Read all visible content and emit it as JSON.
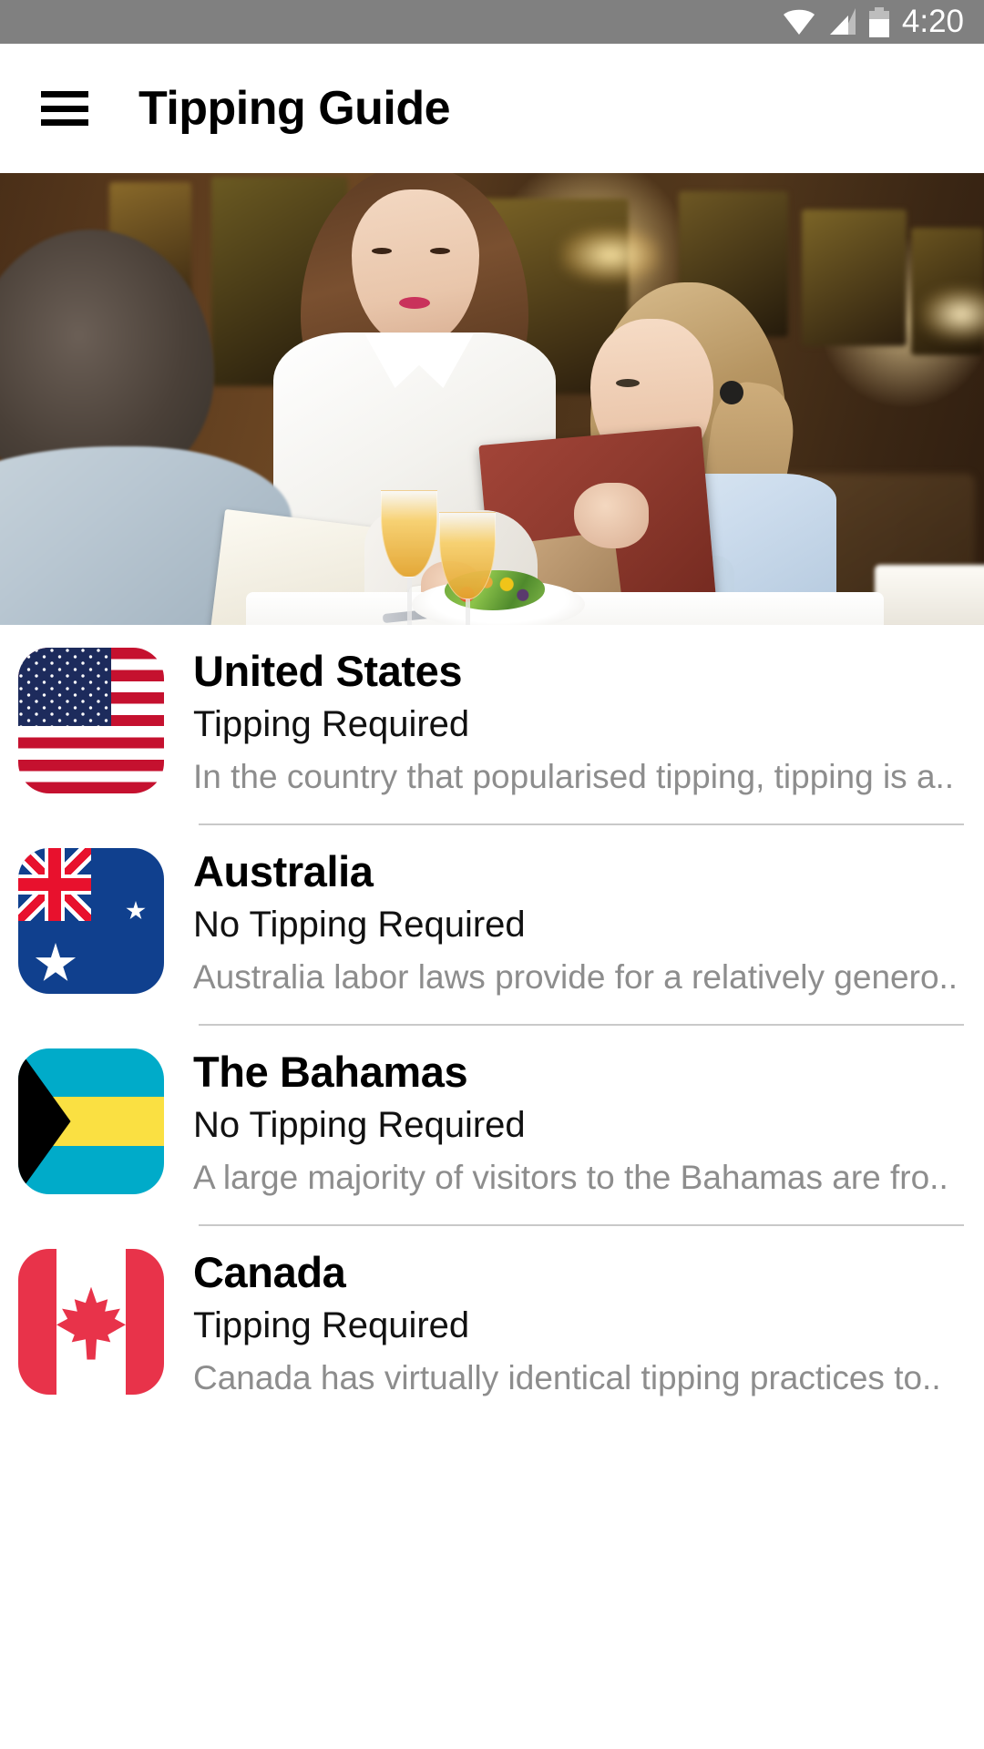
{
  "status_bar": {
    "time": "4:20",
    "icons": [
      "wifi-icon",
      "signal-icon",
      "battery-icon"
    ]
  },
  "app_bar": {
    "menu_icon": "hamburger-menu-icon",
    "title": "Tipping Guide"
  },
  "hero": {
    "alt": "restaurant-scene-waitress-taking-order"
  },
  "list": {
    "items": [
      {
        "flag": "united-states-flag",
        "country": "United States",
        "status": "Tipping Required",
        "description": "In the country that popularised tipping, tipping is a.."
      },
      {
        "flag": "australia-flag",
        "country": "Australia",
        "status": "No Tipping Required",
        "description": "Australia labor laws provide for a relatively genero.."
      },
      {
        "flag": "bahamas-flag",
        "country": "The Bahamas",
        "status": "No Tipping Required",
        "description": "A large majority of visitors to the Bahamas are fro.."
      },
      {
        "flag": "canada-flag",
        "country": "Canada",
        "status": "Tipping Required",
        "description": "Canada has virtually identical tipping practices to.."
      }
    ]
  },
  "colors": {
    "status_bar_bg": "#808080",
    "app_bar_bg": "#ffffff",
    "title_text": "#000000",
    "status_text": "#111111",
    "description_text": "#8d8d8d",
    "divider": "#c9c9c9"
  }
}
